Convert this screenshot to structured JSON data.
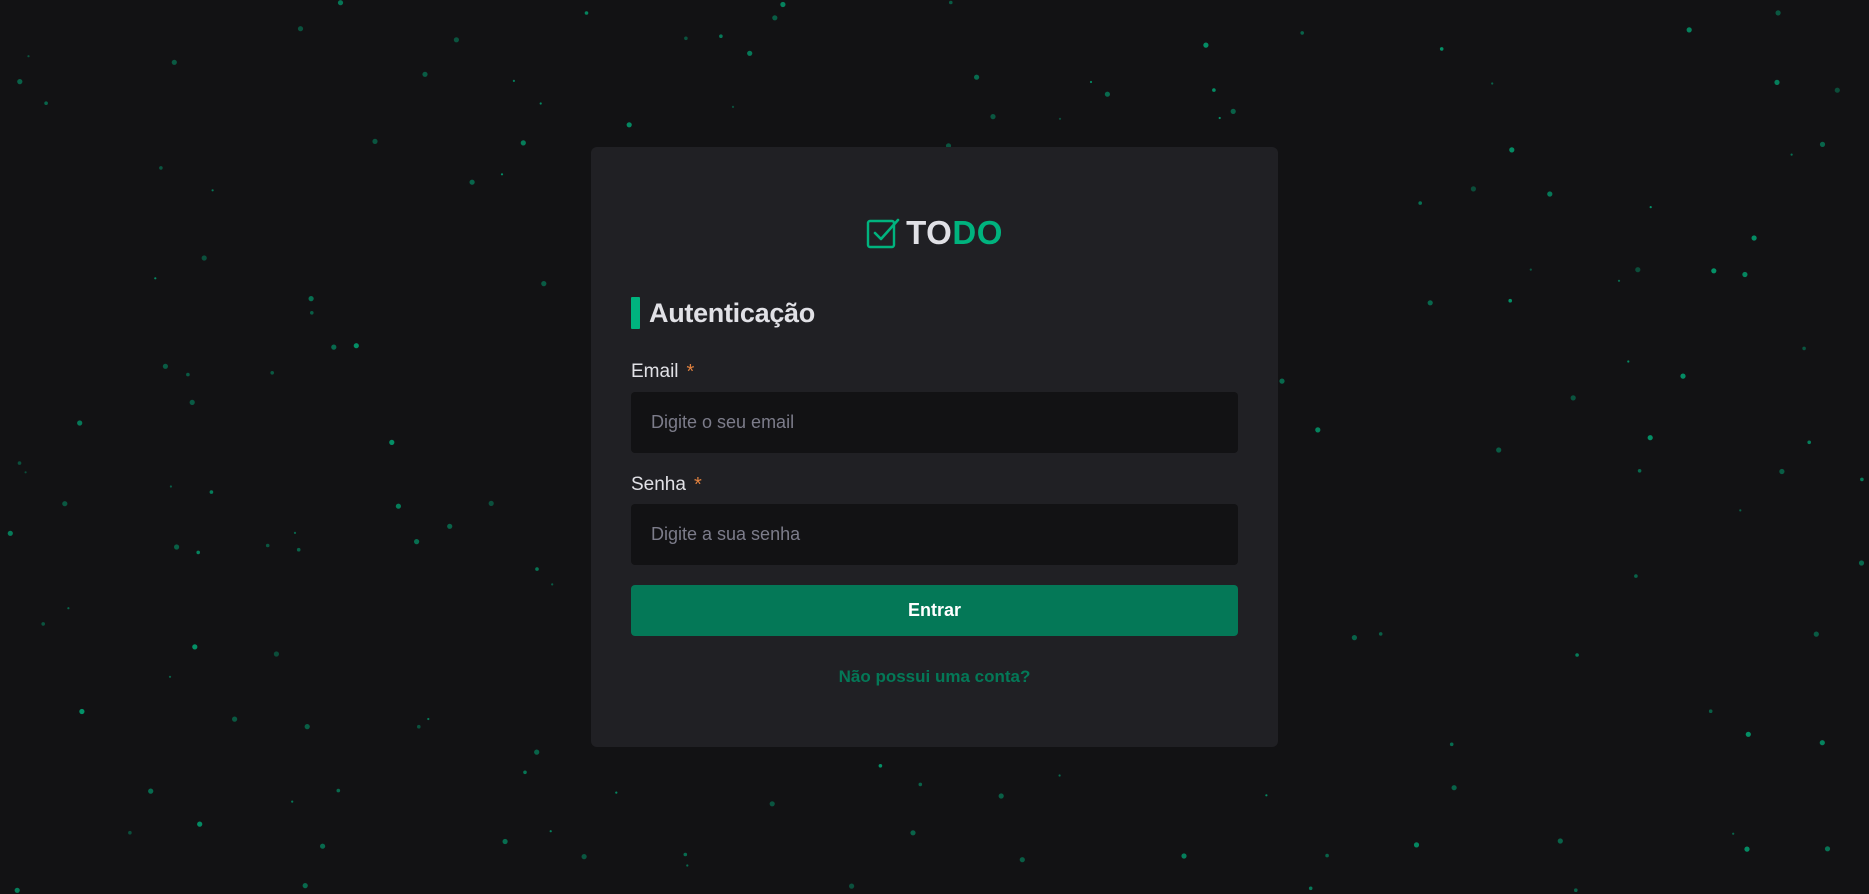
{
  "theme": {
    "background": "#121214",
    "card": "#202024",
    "accent": "#00b37e",
    "button": "#047857",
    "required": "#e0813f",
    "text": "#e1e1e6",
    "placeholder": "#7c7c8a"
  },
  "logo": {
    "icon": "checkbox-check-icon",
    "text_part1": "TO",
    "text_part2": "DO"
  },
  "form": {
    "title": "Autenticação",
    "email": {
      "label": "Email",
      "required_mark": "*",
      "placeholder": "Digite o seu email",
      "value": ""
    },
    "password": {
      "label": "Senha",
      "required_mark": "*",
      "placeholder": "Digite a sua senha",
      "value": ""
    },
    "submit_label": "Entrar",
    "signup_link": "Não possui uma conta?"
  }
}
